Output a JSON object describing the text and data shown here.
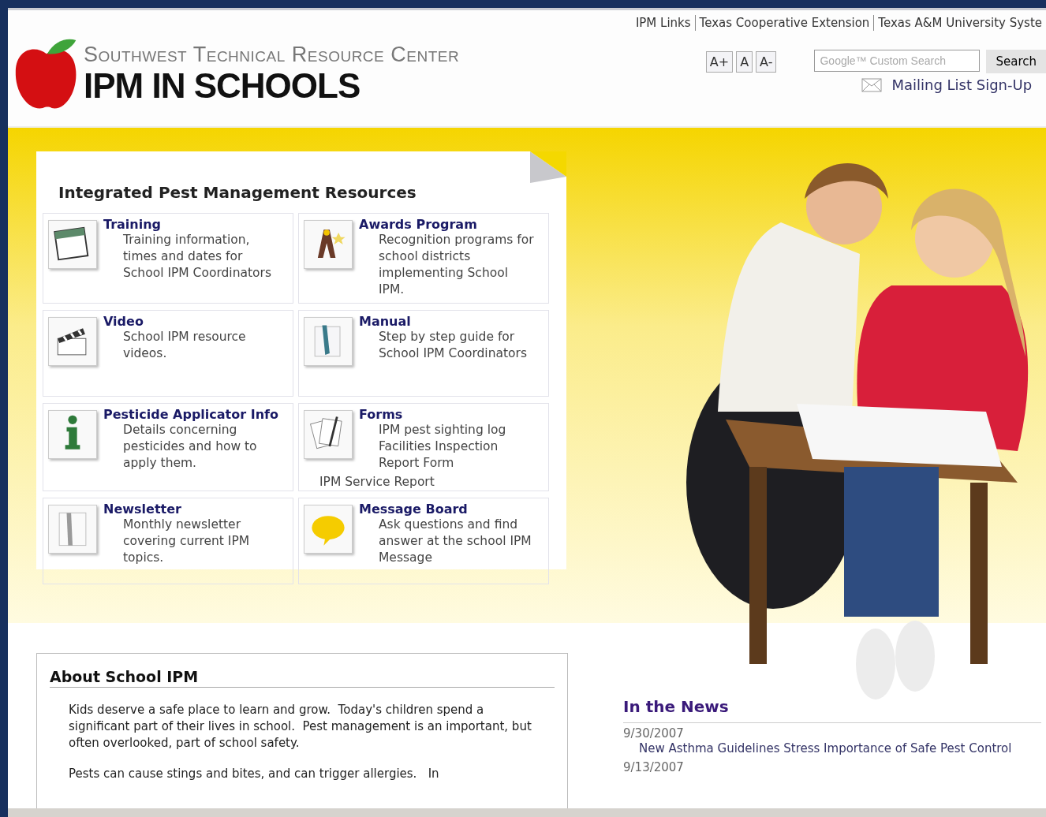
{
  "top_links": [
    "IPM Links",
    "Texas Cooperative Extension",
    "Texas A&M University Syste"
  ],
  "logo": {
    "subtitle": "Southwest Technical Resource Center",
    "title": "IPM IN SCHOOLS"
  },
  "font_size_buttons": [
    "A+",
    "A",
    "A-"
  ],
  "search": {
    "placeholder": "Google™ Custom Search",
    "button": "Search"
  },
  "mailing_link": "Mailing List Sign-Up",
  "resources": {
    "title": "Integrated Pest Management Resources",
    "items": [
      {
        "kind": "calendar",
        "title": "Training",
        "description": "Training information, times and dates for School IPM Coordinators"
      },
      {
        "kind": "award",
        "title": "Awards Program",
        "description": "Recognition programs for school districts implementing School IPM."
      },
      {
        "kind": "video",
        "title": "Video",
        "description": "School IPM resource videos."
      },
      {
        "kind": "manual",
        "title": "Manual",
        "description": "Step by step guide for School IPM Coordinators"
      },
      {
        "kind": "info",
        "title": "Pesticide Applicator Info",
        "description": "Details concerning pesticides and how to apply them."
      },
      {
        "kind": "forms",
        "title": "Forms",
        "description": "IPM pest sighting log Facilities Inspection Report Form",
        "extra": "IPM Service Report"
      },
      {
        "kind": "newsletter",
        "title": "Newsletter",
        "description": "Monthly newsletter covering current IPM topics."
      },
      {
        "kind": "bubble",
        "title": "Message Board",
        "description": "Ask questions and find answer at the school IPM Message"
      }
    ]
  },
  "about": {
    "title": "About School IPM",
    "paragraphs": [
      "Kids deserve a safe place to learn and grow.  Today's children spend a significant part of their lives in school.  Pest management is an important, but often overlooked, part of school safety.",
      "Pests can cause stings and bites, and can trigger allergies.   In"
    ]
  },
  "news": {
    "title": "In the News",
    "items": [
      {
        "date": "9/30/2007",
        "headline": "New Asthma Guidelines Stress Importance of Safe Pest Control"
      },
      {
        "date": "9/13/2007"
      }
    ]
  }
}
